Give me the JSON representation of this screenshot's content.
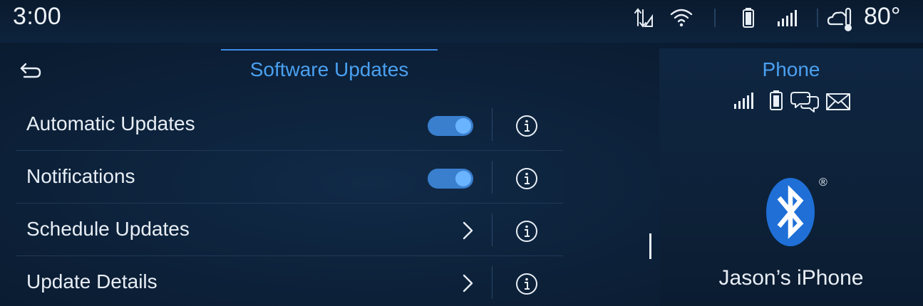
{
  "status_bar": {
    "time": "3:00",
    "icons": [
      "data-transfer-icon",
      "wifi-icon",
      "battery-icon",
      "signal-icon",
      "weather-icon"
    ],
    "temperature": "80°"
  },
  "header": {
    "back_icon": "back-arrow-icon",
    "title": "Software Updates"
  },
  "settings": [
    {
      "label": "Automatic Updates",
      "control": "toggle",
      "on": true,
      "info_icon": "info-icon"
    },
    {
      "label": "Notifications",
      "control": "toggle",
      "on": true,
      "info_icon": "info-icon"
    },
    {
      "label": "Schedule Updates",
      "control": "chevron",
      "info_icon": "info-icon"
    },
    {
      "label": "Update Details",
      "control": "chevron",
      "info_icon": "info-icon"
    }
  ],
  "phone_panel": {
    "title": "Phone",
    "status_icons": [
      "signal-icon",
      "battery-icon",
      "messages-icon",
      "mail-icon"
    ],
    "logo": "bluetooth-logo",
    "registered_mark": "®",
    "device_name": "Jason’s iPhone"
  },
  "colors": {
    "accent": "#4aa0f0",
    "toggle_track": "#3a7fce",
    "toggle_knob": "#6ab3ff",
    "bluetooth": "#1f6fd6",
    "background": "#0c2038"
  }
}
